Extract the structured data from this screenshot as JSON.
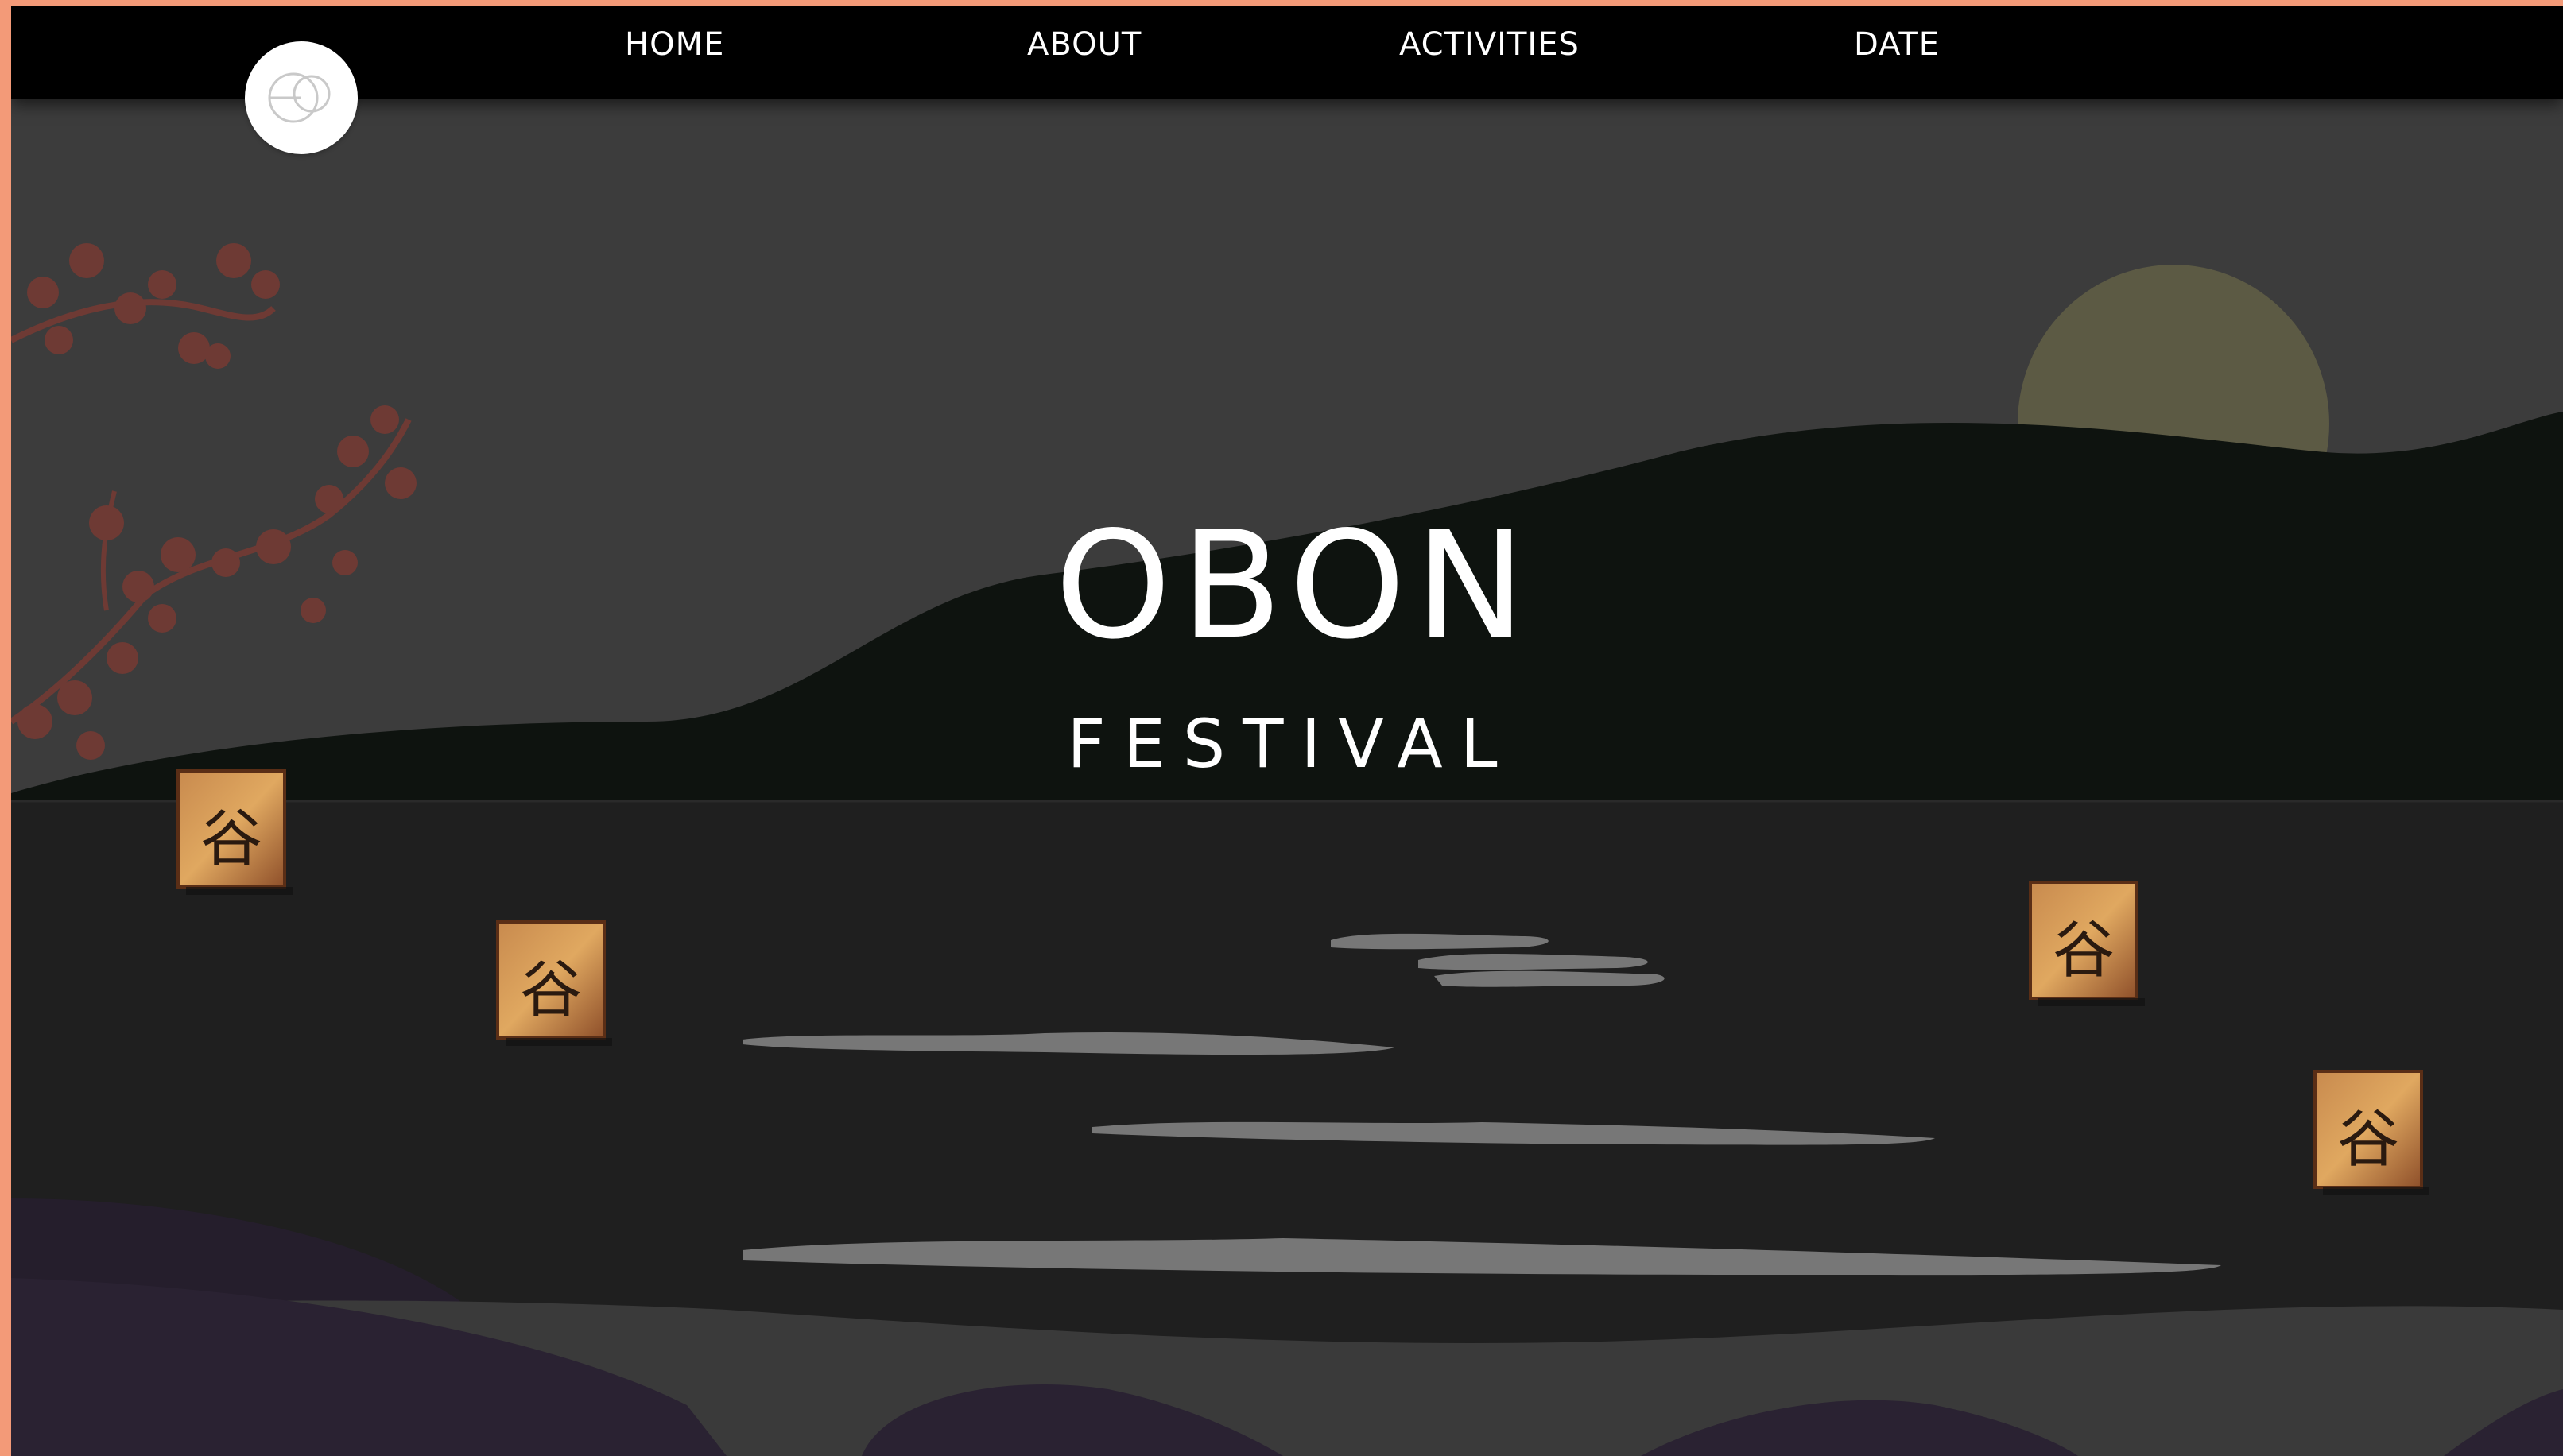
{
  "nav": {
    "items": [
      {
        "label": "HOME"
      },
      {
        "label": "ABOUT"
      },
      {
        "label": "ACTIVITIES"
      },
      {
        "label": "DATE"
      }
    ]
  },
  "logo": {
    "icon": "logo-icon"
  },
  "hero": {
    "title": "OBON",
    "subtitle": "FESTIVAL"
  },
  "decor": {
    "lantern_glyph": "谷"
  },
  "colors": {
    "frame_accent": "#f39a78",
    "nav_background": "#000000",
    "sky": "#3c3c3c",
    "hill": "#0e130f",
    "water": "#1f1f1f",
    "moon": "#5c5a44",
    "blossom": "#6e3a34",
    "lantern": "#b06a3a",
    "foreground_hills": "#251e2c"
  }
}
